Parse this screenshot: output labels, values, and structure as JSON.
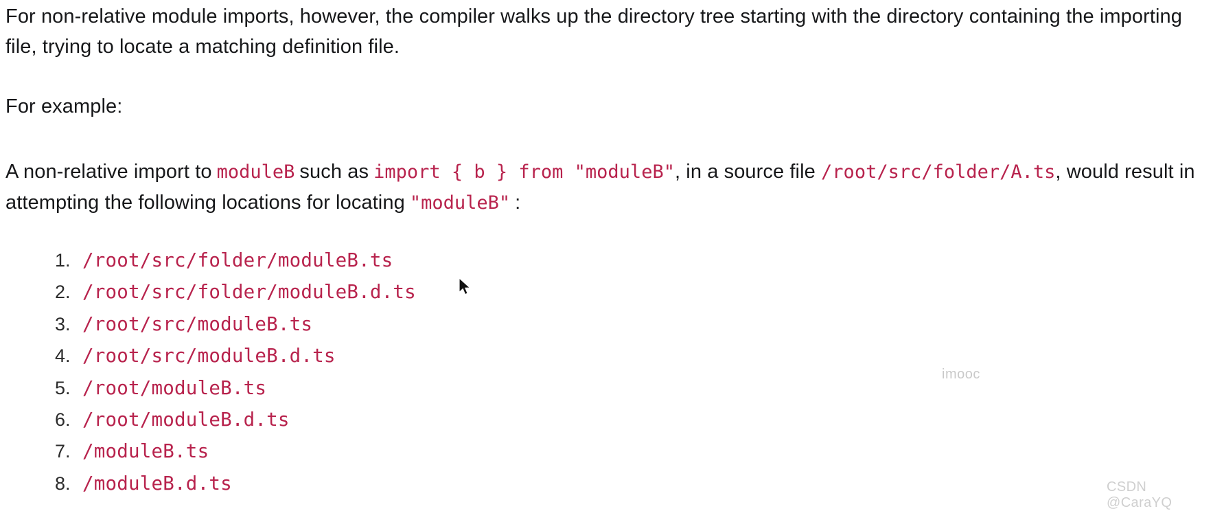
{
  "document": {
    "paragraphs": {
      "intro": {
        "text": "For non-relative module imports, however, the compiler walks up the directory tree starting with the directory containing the importing file, trying to locate a matching definition file."
      },
      "example_lead": {
        "text": "For example:"
      },
      "example_body": {
        "seg1": "A non-relative import to",
        "code1": "moduleB",
        "seg2": "such as",
        "code2": "import { b } from \"moduleB\"",
        "seg3": ", in a source file",
        "code3": "/root/src/folder/A.ts",
        "seg4": ", would result in attempting the following locations for locating",
        "code4": "\"moduleB\"",
        "seg5": ":"
      }
    },
    "locations": [
      "/root/src/folder/moduleB.ts",
      "/root/src/folder/moduleB.d.ts",
      "/root/src/moduleB.ts",
      "/root/src/moduleB.d.ts",
      "/root/moduleB.ts",
      "/root/moduleB.d.ts",
      "/moduleB.ts",
      "/moduleB.d.ts"
    ],
    "watermarks": {
      "imooc": "imooc",
      "csdn": "CSDN @CaraYQ"
    },
    "colors": {
      "code": "#b8234d",
      "body_text": "#17181a",
      "background": "#ffffff",
      "watermark": "#c9c9c9"
    }
  }
}
